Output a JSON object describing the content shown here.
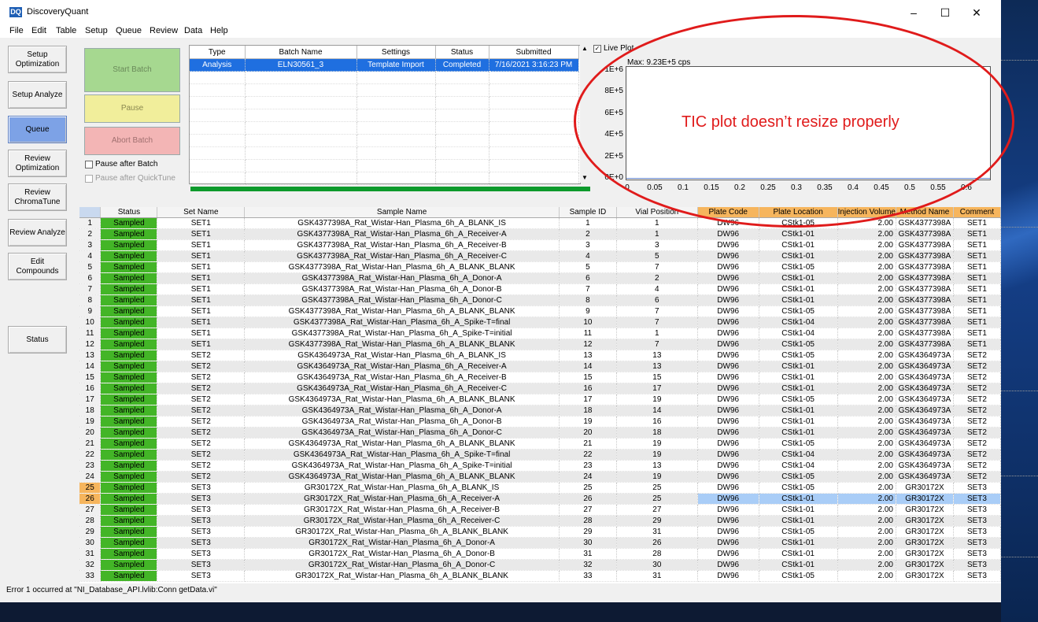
{
  "window": {
    "title": "DiscoveryQuant",
    "logo": "DQ"
  },
  "menu": [
    "File",
    "Edit",
    "Table",
    "Setup",
    "Queue",
    "Review",
    "Data",
    "Help"
  ],
  "nav": [
    {
      "label": "Setup Optimization"
    },
    {
      "label": "Setup Analyze"
    },
    {
      "label": "Queue"
    },
    {
      "label": "Review Optimization"
    },
    {
      "label": "Review ChromaTune"
    },
    {
      "label": "Review Analyze"
    },
    {
      "label": "Edit Compounds"
    },
    {
      "label": "Status"
    }
  ],
  "controls": {
    "start": "Start Batch",
    "pause": "Pause",
    "abort": "Abort Batch",
    "pause_after_batch": "Pause after Batch",
    "pause_after_quicktune": "Pause after QuickTune"
  },
  "batch_table": {
    "headers": [
      "Type",
      "Batch Name",
      "Settings",
      "Status",
      "Submitted"
    ],
    "rows": [
      [
        "Analysis",
        "ELN30561_3",
        "Template Import",
        "Completed",
        "7/16/2021 3:16:23 PM"
      ]
    ]
  },
  "plot": {
    "live_plot_label": "Live Plot",
    "max_label": "Max: 9.23E+5 cps",
    "y_ticks": [
      "1E+6",
      "8E+5",
      "6E+5",
      "4E+5",
      "2E+5",
      "0E+0"
    ],
    "x_ticks": [
      "0",
      "0.05",
      "0.1",
      "0.15",
      "0.2",
      "0.25",
      "0.3",
      "0.35",
      "0.4",
      "0.45",
      "0.5",
      "0.55",
      "0.6"
    ]
  },
  "annotation": "TIC plot doesn’t resize properly",
  "grid": {
    "headers": [
      "Status",
      "Set Name",
      "Sample Name",
      "Sample ID",
      "Vial Position",
      "Plate Code",
      "Plate Location",
      "Injection Volume",
      "Method Name",
      "Comment"
    ],
    "rows": [
      [
        "1",
        "Sampled",
        "SET1",
        "GSK4377398A_Rat_Wistar-Han_Plasma_6h_A_BLANK_IS",
        "1",
        "1",
        "DW96",
        "CStk1-05",
        "2.00",
        "GSK4377398A",
        "SET1"
      ],
      [
        "2",
        "Sampled",
        "SET1",
        "GSK4377398A_Rat_Wistar-Han_Plasma_6h_A_Receiver-A",
        "2",
        "1",
        "DW96",
        "CStk1-01",
        "2.00",
        "GSK4377398A",
        "SET1"
      ],
      [
        "3",
        "Sampled",
        "SET1",
        "GSK4377398A_Rat_Wistar-Han_Plasma_6h_A_Receiver-B",
        "3",
        "3",
        "DW96",
        "CStk1-01",
        "2.00",
        "GSK4377398A",
        "SET1"
      ],
      [
        "4",
        "Sampled",
        "SET1",
        "GSK4377398A_Rat_Wistar-Han_Plasma_6h_A_Receiver-C",
        "4",
        "5",
        "DW96",
        "CStk1-01",
        "2.00",
        "GSK4377398A",
        "SET1"
      ],
      [
        "5",
        "Sampled",
        "SET1",
        "GSK4377398A_Rat_Wistar-Han_Plasma_6h_A_BLANK_BLANK",
        "5",
        "7",
        "DW96",
        "CStk1-05",
        "2.00",
        "GSK4377398A",
        "SET1"
      ],
      [
        "6",
        "Sampled",
        "SET1",
        "GSK4377398A_Rat_Wistar-Han_Plasma_6h_A_Donor-A",
        "6",
        "2",
        "DW96",
        "CStk1-01",
        "2.00",
        "GSK4377398A",
        "SET1"
      ],
      [
        "7",
        "Sampled",
        "SET1",
        "GSK4377398A_Rat_Wistar-Han_Plasma_6h_A_Donor-B",
        "7",
        "4",
        "DW96",
        "CStk1-01",
        "2.00",
        "GSK4377398A",
        "SET1"
      ],
      [
        "8",
        "Sampled",
        "SET1",
        "GSK4377398A_Rat_Wistar-Han_Plasma_6h_A_Donor-C",
        "8",
        "6",
        "DW96",
        "CStk1-01",
        "2.00",
        "GSK4377398A",
        "SET1"
      ],
      [
        "9",
        "Sampled",
        "SET1",
        "GSK4377398A_Rat_Wistar-Han_Plasma_6h_A_BLANK_BLANK",
        "9",
        "7",
        "DW96",
        "CStk1-05",
        "2.00",
        "GSK4377398A",
        "SET1"
      ],
      [
        "10",
        "Sampled",
        "SET1",
        "GSK4377398A_Rat_Wistar-Han_Plasma_6h_A_Spike-T=final",
        "10",
        "7",
        "DW96",
        "CStk1-04",
        "2.00",
        "GSK4377398A",
        "SET1"
      ],
      [
        "11",
        "Sampled",
        "SET1",
        "GSK4377398A_Rat_Wistar-Han_Plasma_6h_A_Spike-T=initial",
        "11",
        "1",
        "DW96",
        "CStk1-04",
        "2.00",
        "GSK4377398A",
        "SET1"
      ],
      [
        "12",
        "Sampled",
        "SET1",
        "GSK4377398A_Rat_Wistar-Han_Plasma_6h_A_BLANK_BLANK",
        "12",
        "7",
        "DW96",
        "CStk1-05",
        "2.00",
        "GSK4377398A",
        "SET1"
      ],
      [
        "13",
        "Sampled",
        "SET2",
        "GSK4364973A_Rat_Wistar-Han_Plasma_6h_A_BLANK_IS",
        "13",
        "13",
        "DW96",
        "CStk1-05",
        "2.00",
        "GSK4364973A",
        "SET2"
      ],
      [
        "14",
        "Sampled",
        "SET2",
        "GSK4364973A_Rat_Wistar-Han_Plasma_6h_A_Receiver-A",
        "14",
        "13",
        "DW96",
        "CStk1-01",
        "2.00",
        "GSK4364973A",
        "SET2"
      ],
      [
        "15",
        "Sampled",
        "SET2",
        "GSK4364973A_Rat_Wistar-Han_Plasma_6h_A_Receiver-B",
        "15",
        "15",
        "DW96",
        "CStk1-01",
        "2.00",
        "GSK4364973A",
        "SET2"
      ],
      [
        "16",
        "Sampled",
        "SET2",
        "GSK4364973A_Rat_Wistar-Han_Plasma_6h_A_Receiver-C",
        "16",
        "17",
        "DW96",
        "CStk1-01",
        "2.00",
        "GSK4364973A",
        "SET2"
      ],
      [
        "17",
        "Sampled",
        "SET2",
        "GSK4364973A_Rat_Wistar-Han_Plasma_6h_A_BLANK_BLANK",
        "17",
        "19",
        "DW96",
        "CStk1-05",
        "2.00",
        "GSK4364973A",
        "SET2"
      ],
      [
        "18",
        "Sampled",
        "SET2",
        "GSK4364973A_Rat_Wistar-Han_Plasma_6h_A_Donor-A",
        "18",
        "14",
        "DW96",
        "CStk1-01",
        "2.00",
        "GSK4364973A",
        "SET2"
      ],
      [
        "19",
        "Sampled",
        "SET2",
        "GSK4364973A_Rat_Wistar-Han_Plasma_6h_A_Donor-B",
        "19",
        "16",
        "DW96",
        "CStk1-01",
        "2.00",
        "GSK4364973A",
        "SET2"
      ],
      [
        "20",
        "Sampled",
        "SET2",
        "GSK4364973A_Rat_Wistar-Han_Plasma_6h_A_Donor-C",
        "20",
        "18",
        "DW96",
        "CStk1-01",
        "2.00",
        "GSK4364973A",
        "SET2"
      ],
      [
        "21",
        "Sampled",
        "SET2",
        "GSK4364973A_Rat_Wistar-Han_Plasma_6h_A_BLANK_BLANK",
        "21",
        "19",
        "DW96",
        "CStk1-05",
        "2.00",
        "GSK4364973A",
        "SET2"
      ],
      [
        "22",
        "Sampled",
        "SET2",
        "GSK4364973A_Rat_Wistar-Han_Plasma_6h_A_Spike-T=final",
        "22",
        "19",
        "DW96",
        "CStk1-04",
        "2.00",
        "GSK4364973A",
        "SET2"
      ],
      [
        "23",
        "Sampled",
        "SET2",
        "GSK4364973A_Rat_Wistar-Han_Plasma_6h_A_Spike-T=initial",
        "23",
        "13",
        "DW96",
        "CStk1-04",
        "2.00",
        "GSK4364973A",
        "SET2"
      ],
      [
        "24",
        "Sampled",
        "SET2",
        "GSK4364973A_Rat_Wistar-Han_Plasma_6h_A_BLANK_BLANK",
        "24",
        "19",
        "DW96",
        "CStk1-05",
        "2.00",
        "GSK4364973A",
        "SET2"
      ],
      [
        "25",
        "Sampled",
        "SET3",
        "GR30172X_Rat_Wistar-Han_Plasma_6h_A_BLANK_IS",
        "25",
        "25",
        "DW96",
        "CStk1-05",
        "2.00",
        "GR30172X",
        "SET3"
      ],
      [
        "26",
        "Sampled",
        "SET3",
        "GR30172X_Rat_Wistar-Han_Plasma_6h_A_Receiver-A",
        "26",
        "25",
        "DW96",
        "CStk1-01",
        "2.00",
        "GR30172X",
        "SET3"
      ],
      [
        "27",
        "Sampled",
        "SET3",
        "GR30172X_Rat_Wistar-Han_Plasma_6h_A_Receiver-B",
        "27",
        "27",
        "DW96",
        "CStk1-01",
        "2.00",
        "GR30172X",
        "SET3"
      ],
      [
        "28",
        "Sampled",
        "SET3",
        "GR30172X_Rat_Wistar-Han_Plasma_6h_A_Receiver-C",
        "28",
        "29",
        "DW96",
        "CStk1-01",
        "2.00",
        "GR30172X",
        "SET3"
      ],
      [
        "29",
        "Sampled",
        "SET3",
        "GR30172X_Rat_Wistar-Han_Plasma_6h_A_BLANK_BLANK",
        "29",
        "31",
        "DW96",
        "CStk1-05",
        "2.00",
        "GR30172X",
        "SET3"
      ],
      [
        "30",
        "Sampled",
        "SET3",
        "GR30172X_Rat_Wistar-Han_Plasma_6h_A_Donor-A",
        "30",
        "26",
        "DW96",
        "CStk1-01",
        "2.00",
        "GR30172X",
        "SET3"
      ],
      [
        "31",
        "Sampled",
        "SET3",
        "GR30172X_Rat_Wistar-Han_Plasma_6h_A_Donor-B",
        "31",
        "28",
        "DW96",
        "CStk1-01",
        "2.00",
        "GR30172X",
        "SET3"
      ],
      [
        "32",
        "Sampled",
        "SET3",
        "GR30172X_Rat_Wistar-Han_Plasma_6h_A_Donor-C",
        "32",
        "30",
        "DW96",
        "CStk1-01",
        "2.00",
        "GR30172X",
        "SET3"
      ],
      [
        "33",
        "Sampled",
        "SET3",
        "GR30172X_Rat_Wistar-Han_Plasma_6h_A_BLANK_BLANK",
        "33",
        "31",
        "DW96",
        "CStk1-05",
        "2.00",
        "GR30172X",
        "SET3"
      ]
    ]
  },
  "error": "Error 1 occurred at \"NI_Database_API.lvlib:Conn getData.vi\"",
  "colors": {
    "sampled": "#43b527",
    "progress": "#0d9a2c",
    "orange_header": "#f6b55d",
    "selection": "#1f6fe0",
    "annotation": "#e01b1b"
  }
}
